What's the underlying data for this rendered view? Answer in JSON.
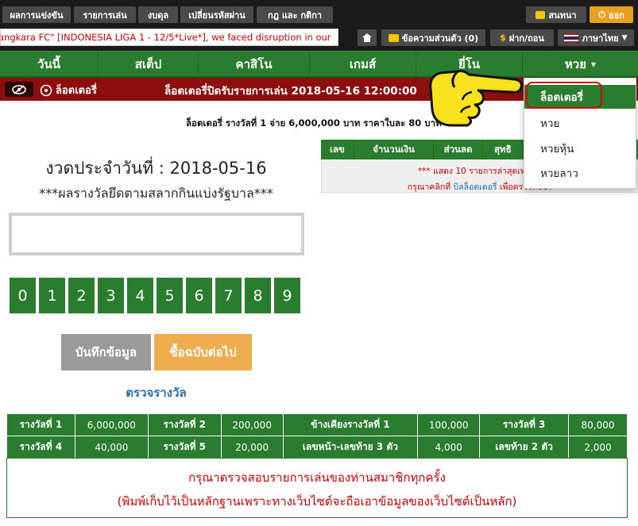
{
  "topbar": {
    "buttons": [
      "ผลการแข่งขัน",
      "รายการเล่น",
      "งบดุล",
      "เปลี่ยนรหัสผ่าน",
      "กฎ และ กติกา"
    ],
    "chat_label": "สนทนา",
    "logout_label": "ออก",
    "ticker_text": "angkara FC\" [INDONESIA LIGA 1 - 12/5*Live*], we faced disruption in our",
    "messages_label": "ข้อความส่วนตัว (0)",
    "deposit_label": "ฝาก/ถอน",
    "language_label": "ภาษาไทย"
  },
  "nav": {
    "items": [
      "วันนี้",
      "สเต็ป",
      "คาสิโน",
      "เกมส์",
      "ยี่โน",
      "หวย"
    ],
    "caret": "▾"
  },
  "redbar": {
    "lottery_label": "ล็อตเตอรี่",
    "closed_text": "ล็อตเตอรี่ปิดรับรายการเล่น 2018-05-16 12:00:00"
  },
  "dropdown": {
    "items": [
      "ล็อตเตอรี่",
      "หวย",
      "หวยหุ้น",
      "หวยลาว"
    ]
  },
  "prize_line": "ล็อตเตอรี่ รางวัลที่ 1 จ่าย 6,000,000 บาท ราคาใบละ 80 บาท",
  "history": {
    "headers": [
      "เลข",
      "จำนวนเงิน",
      "ส่วนลด",
      "สุทธิ"
    ],
    "line1": "*** แสดง 10 รายการล่าสุดเท่านั้น",
    "line2_prefix": "กรุณาคลิกที่ ",
    "line2_link": "บิลล็อตเตอรี่",
    "line2_suffix": " เพื่อตรวจสอบร"
  },
  "draw": {
    "title": "งวดประจำวันที่ : 2018-05-16",
    "rule": "***ผลรางวัลยึดตามสลากกินแบ่งรัฐบาล***",
    "number_value": ""
  },
  "digits": [
    "0",
    "1",
    "2",
    "3",
    "4",
    "5",
    "6",
    "7",
    "8",
    "9"
  ],
  "buttons": {
    "save": "บันทึกข้อมูล",
    "buy_next": "ซื้อฉบับต่อไป",
    "check_prize": "ตรวจรางวัล"
  },
  "prize_table": [
    [
      "รางวัลที่ 1",
      "6,000,000",
      "รางวัลที่ 2",
      "200,000",
      "ข้างเคียงรางวัลที่ 1",
      "100,000",
      "รางวัลที่ 3",
      "80,000"
    ],
    [
      "รางวัลที่ 4",
      "40,000",
      "รางวัลที่ 5",
      "20,000",
      "เลขหน้า-เลขท้าย 3 ตัว",
      "4,000",
      "เลขท้าย 2 ตัว",
      "2,000"
    ]
  ],
  "notice": {
    "line1": "กรุณาตรวจสอบรายการเล่นของท่านสมาชิกทุกครั้ง",
    "line2": "(พิมพ์เก็บไว้เป็นหลักฐานเพราะทางเว็บไซต์จะถือเอาข้อมูลของเว็บไซต์เป็นหลัก)"
  },
  "colors": {
    "green": "#2a7d2e",
    "red_bar": "#8c0e0e",
    "orange": "#f0ad4e",
    "gray_button": "#9a9a9a"
  }
}
